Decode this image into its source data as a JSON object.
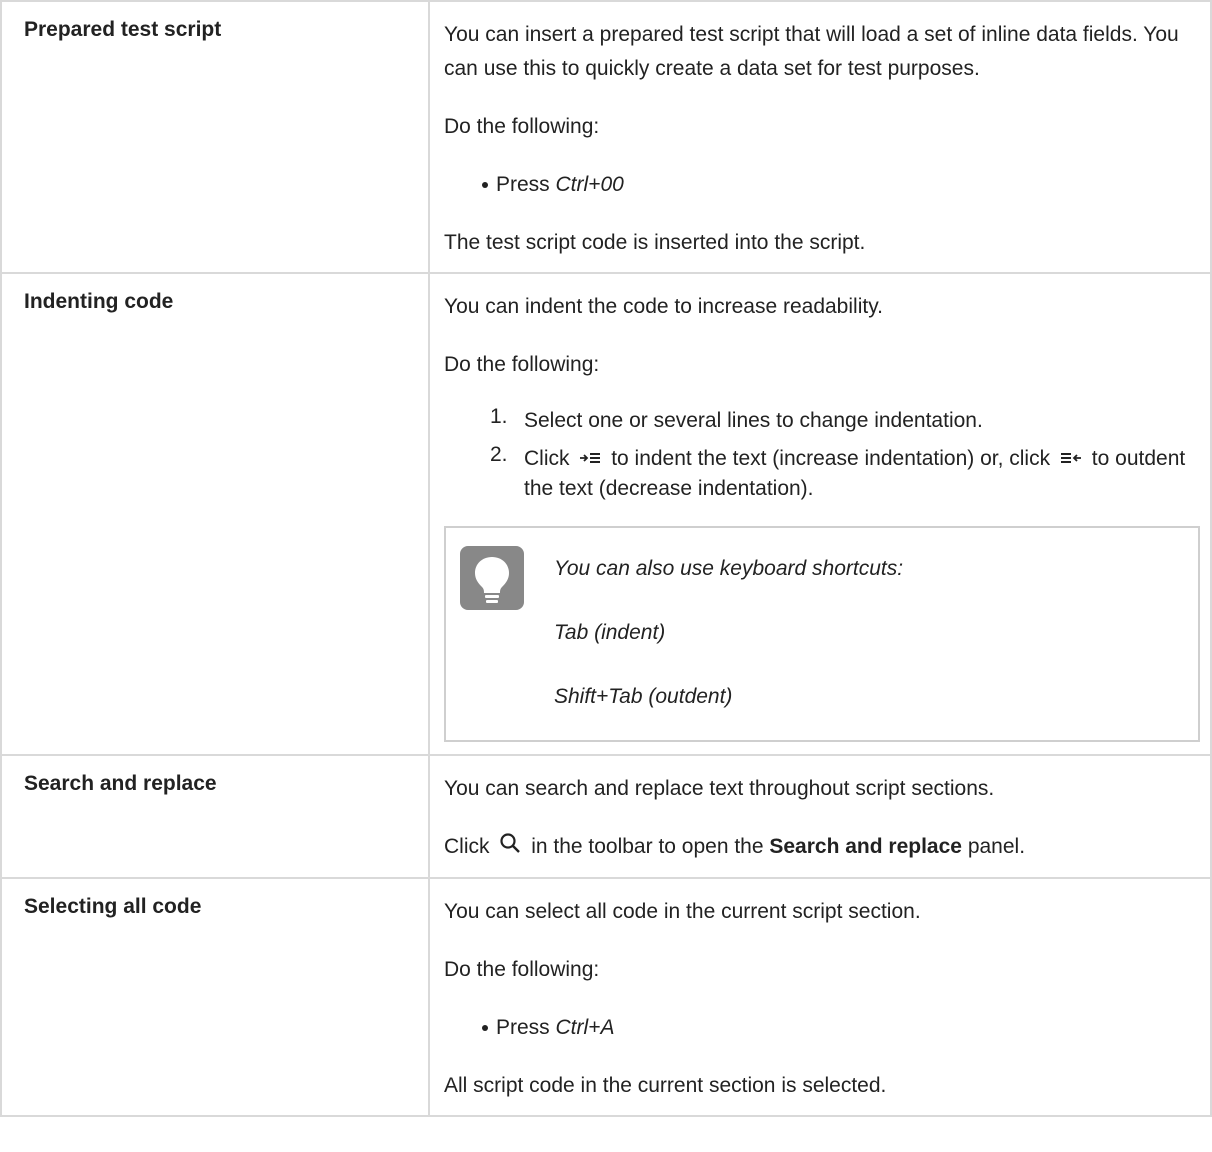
{
  "rows": [
    {
      "term": "Prepared test script",
      "intro": "You can insert a prepared test script that will load a set of inline data fields. You can use this to quickly create a data set for test purposes.",
      "do_following": "Do the following:",
      "step_prefix": "Press ",
      "step_key": "Ctrl+00",
      "result": "The test script code is inserted into the script."
    },
    {
      "term": "Indenting code",
      "intro": "You can indent the code to increase readability.",
      "do_following": "Do the following:",
      "steps": [
        {
          "num": "1.",
          "text": "Select one or several lines to change indentation."
        },
        {
          "num": "2.",
          "pre": "Click",
          "mid": "to indent the text (increase indentation) or, click",
          "post": "to outdent the text (decrease indentation)."
        }
      ],
      "tip": {
        "line1": "You can also use keyboard shortcuts:",
        "line2": "Tab (indent)",
        "line3": "Shift+Tab (outdent)"
      }
    },
    {
      "term": "Search and replace",
      "intro": "You can search and replace text throughout script sections.",
      "click": "Click",
      "click_mid": "in the toolbar to open the",
      "panel_name": "Search and replace",
      "panel_suffix": "panel."
    },
    {
      "term": "Selecting all code",
      "intro": "You can select all code in the current script section.",
      "do_following": "Do the following:",
      "step_prefix": "Press ",
      "step_key": "Ctrl+A",
      "result": "All script code in the current section is selected."
    }
  ],
  "icons": {
    "indent": "indent-icon",
    "outdent": "outdent-icon",
    "search": "search-icon",
    "tip": "lightbulb-icon"
  }
}
